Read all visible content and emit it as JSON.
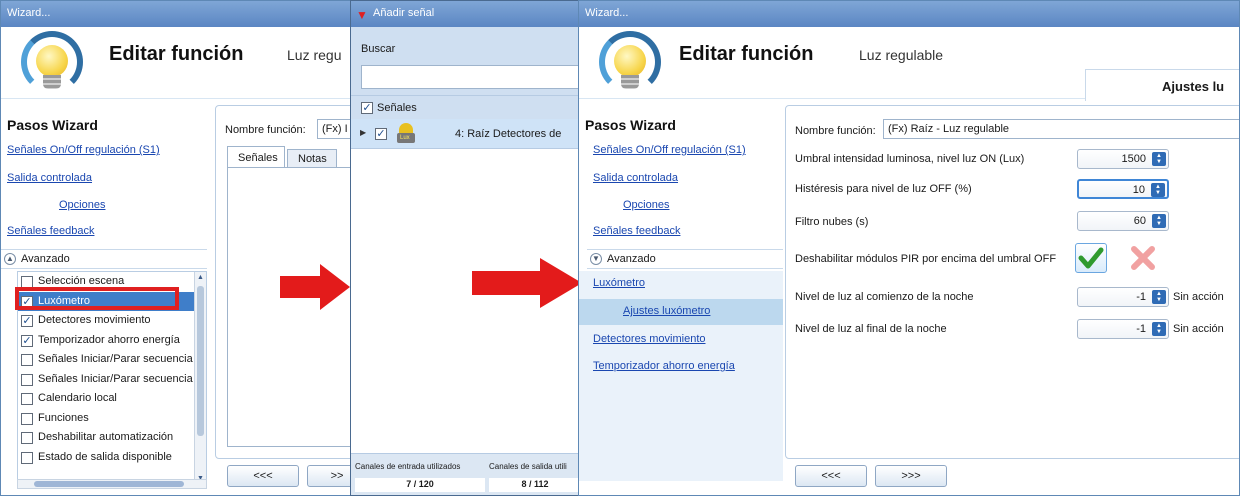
{
  "wizard1": {
    "title": "Wizard...",
    "header_title": "Editar función",
    "header_sub": "Luz regu",
    "steps_title": "Pasos Wizard",
    "steps": [
      "Señales On/Off regulación (S1)",
      "Salida controlada",
      "Opciones",
      "Señales feedback"
    ],
    "advanced_label": "Avanzado",
    "items": [
      {
        "label": "Selección escena",
        "checked": false
      },
      {
        "label": "Luxómetro",
        "checked": true,
        "selected": true
      },
      {
        "label": "Detectores movimiento",
        "checked": true
      },
      {
        "label": "Temporizador ahorro energía",
        "checked": true
      },
      {
        "label": "Señales Iniciar/Parar secuencia",
        "checked": false
      },
      {
        "label": "Señales Iniciar/Parar secuencia",
        "checked": false
      },
      {
        "label": "Calendario local",
        "checked": false
      },
      {
        "label": "Funciones",
        "checked": false
      },
      {
        "label": "Deshabilitar automatización",
        "checked": false
      },
      {
        "label": "Estado de salida disponible",
        "checked": false
      }
    ],
    "name_label": "Nombre función:",
    "name_value": "(Fx) I",
    "tabs": [
      "Señales",
      "Notas"
    ],
    "back_btn": "<<<",
    "next_btn": ">>"
  },
  "dialog": {
    "title": "Añadir señal",
    "search_label": "Buscar",
    "search_value": "",
    "signals_label": "Señales",
    "row_label": "4: Raíz Detectores de",
    "footer_in_label": "Canales de entrada utilizados",
    "footer_out_label": "Canales de salida utili",
    "footer_in_value": "7 / 120",
    "footer_out_value": "8 / 112"
  },
  "wizard2": {
    "title": "Wizard...",
    "header_title": "Editar función",
    "header_sub": "Luz regulable",
    "right_tab": "Ajustes lu",
    "steps_title": "Pasos Wizard",
    "steps": [
      "Señales On/Off regulación (S1)",
      "Salida controlada",
      "Opciones",
      "Señales feedback"
    ],
    "advanced_label": "Avanzado",
    "adv_items": [
      "Luxómetro",
      "Ajustes luxómetro",
      "Detectores movimiento",
      "Temporizador ahorro energía"
    ],
    "form": {
      "name_label": "Nombre función:",
      "name_value": "(Fx) Raíz - Luz regulable",
      "lux_on_label": "Umbral intensidad luminosa, nivel luz ON (Lux)",
      "lux_on_value": "1500",
      "hyst_label": "Histéresis para nivel de luz OFF (%)",
      "hyst_value": "10",
      "clouds_label": "Filtro nubes (s)",
      "clouds_value": "60",
      "pir_label": "Deshabilitar módulos PIR por encima del umbral OFF",
      "night_start_label": "Nivel de luz al comienzo de la noche",
      "night_start_value": "-1",
      "night_end_label": "Nivel de luz al final de la noche",
      "night_end_value": "-1",
      "no_action": "Sin acción"
    },
    "back_btn": "<<<",
    "next_btn": ">>>"
  },
  "colors": {
    "accent": "#2f6bb5",
    "arrow": "#e31b1b",
    "selection": "#cfe3f7",
    "highlight_box": "#e02020"
  }
}
